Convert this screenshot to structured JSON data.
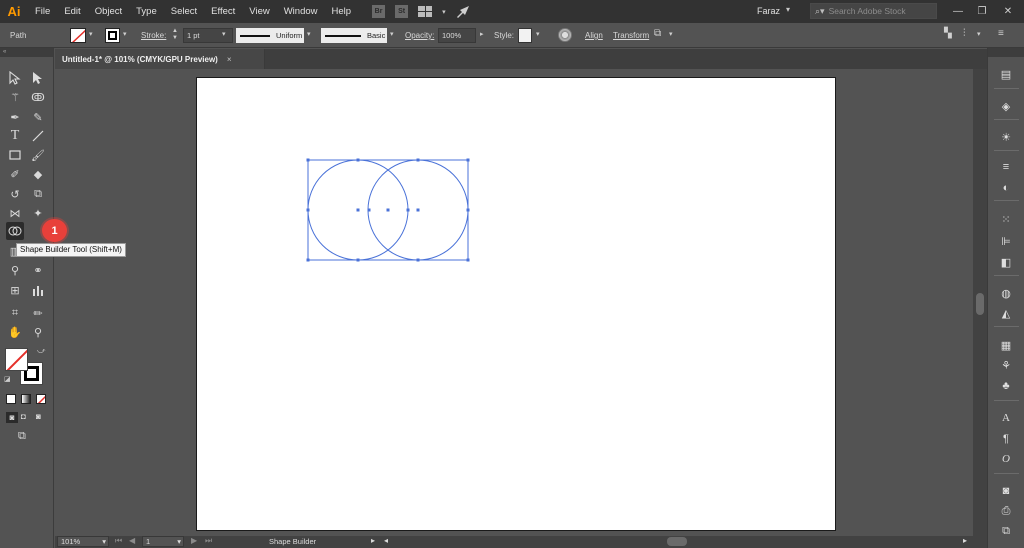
{
  "app": {
    "logo": "Ai",
    "accent": "#ff9a00"
  },
  "menu": [
    "File",
    "Edit",
    "Object",
    "Type",
    "Select",
    "Effect",
    "View",
    "Window",
    "Help"
  ],
  "menubar_icons": {
    "bridge": "Br",
    "stock": "St"
  },
  "user": {
    "name": "Faraz"
  },
  "search": {
    "placeholder": "Search Adobe Stock"
  },
  "control": {
    "selection_label": "Path",
    "stroke_label": "Stroke:",
    "stroke_weight": "1 pt",
    "profile": "Uniform",
    "brush": "Basic",
    "opacity_label": "Opacity:",
    "opacity_value": "100%",
    "style_label": "Style:",
    "align_label": "Align",
    "transform_label": "Transform"
  },
  "document": {
    "tab_title": "Untitled-1* @ 101% (CMYK/GPU Preview)",
    "close": "×"
  },
  "tooltip": {
    "text": "Shape Builder Tool (Shift+M)"
  },
  "callout": {
    "number": "1",
    "color": "#e8403a"
  },
  "status": {
    "zoom": "101%",
    "artboard_number": "1",
    "current_tool": "Shape Builder"
  },
  "selection_color": "#4a72d8"
}
